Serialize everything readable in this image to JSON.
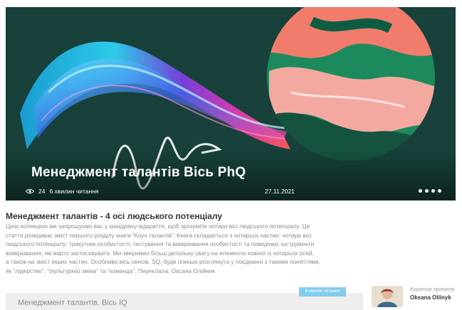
{
  "hero": {
    "title": "Менеджмент талантів Вісь PhQ",
    "views": "24",
    "read_time": "6 хвилин читання",
    "date": "27.11.2021",
    "slide_count": 4
  },
  "article": {
    "title": "Менеджмент талантів - 4 осі людського потенціалу",
    "body_lines": [
      "Цією колекцією ми запрошуємо вас у мандрівку-відкриття, щоб зрозуміти чотири вісі людського потенціалу. Ця",
      "стаття розкриває зміст першого розділу книги “Коуч талантів”. Книга складається з чотирьох частин: чотири вісі",
      "людського потенціалу; трикутник особистості; тестування та вимірювання особистості та поведінки; інструменти",
      "вимірювання, які варто застосовувати. Ми звернемо більш детальну увагу на елементи кожної із чотирьох осей,",
      "а також на зміст інших частин. Особливо вісь сенсів, SQ, буде пізніше розглянута у поєднанні з такими поняттями,",
      "як “лідерство”, “(культурна) зміна” та “команда”. Переклала: Оксана Олійник"
    ]
  },
  "next_card": {
    "title": "Менеджмент талантів. Вісь IQ",
    "badge": "8 хвилин читання"
  },
  "curator": {
    "label": "Куратор проєкту",
    "name": "Oksana Oliinyk"
  },
  "colors": {
    "hero_bg": "#16362f",
    "badge": "#82cdeb",
    "circle_pink": "#f4a9a0",
    "circle_green": "#1d8a5e"
  }
}
